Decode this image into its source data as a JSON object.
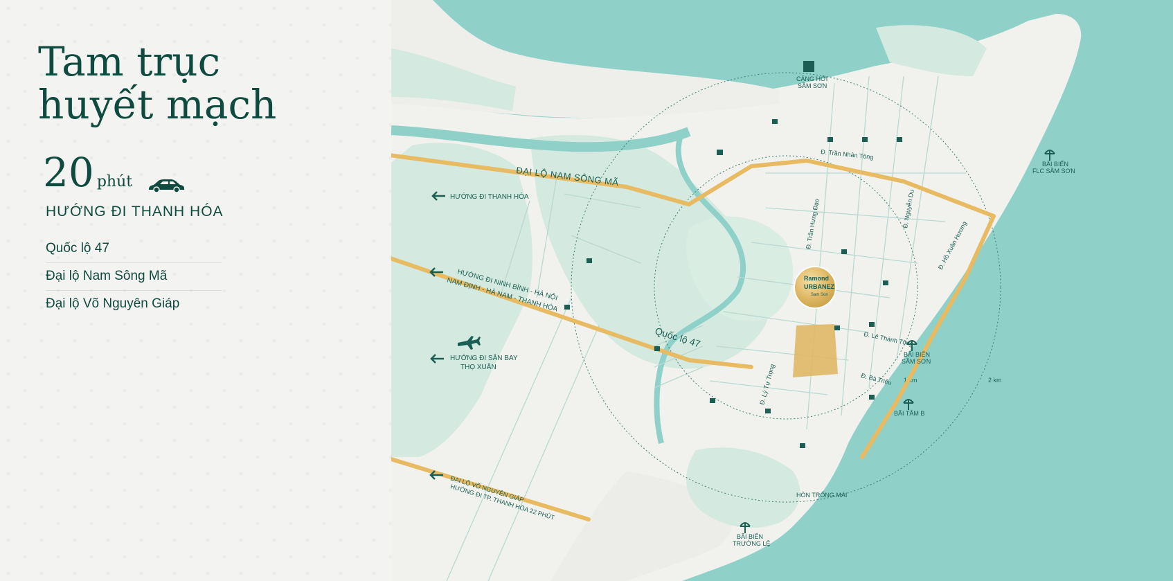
{
  "left": {
    "title_line1": "Tam trục",
    "title_line2": "huyết mạch",
    "duration_value": "20",
    "duration_unit": "phút",
    "direction": "HƯỚNG ĐI THANH HÓA",
    "routes": [
      "Quốc lộ 47",
      "Đại lộ Nam Sông Mã",
      "Đại lộ Võ Nguyên Giáp"
    ]
  },
  "map": {
    "roads": {
      "nam_song_ma": "ĐẠI LỘ NAM SÔNG MÃ",
      "quoc_lo_47": "Quốc lộ 47",
      "vo_nguyen_giap": "ĐẠI LỘ VÕ NGUYÊN GIÁP",
      "ho_xuan_huong": "Đ. Hồ Xuân Hương",
      "le_thanh_tong": "Đ. Lê Thánh Tông",
      "ba_trieu": "Đ. Bà Triệu",
      "ly_tu_trong": "Đ. Lý Tự Trọng",
      "tran_nhan_tong": "Đ. Trần Nhân Tông",
      "nguyen_du": "Đ. Nguyễn Du",
      "tran_hung_dao": "Đ. Trần Hưng Đạo"
    },
    "directions": {
      "thanh_hoa": "HƯỚNG ĐI THANH HÓA",
      "ninh_binh_1": "HƯỚNG ĐI NINH BÌNH - HÀ NỘI",
      "ninh_binh_2": "NAM ĐỊNH - HÀ NAM - THANH HÓA",
      "airport_1": "HƯỚNG ĐI SÂN BAY",
      "airport_2": "THỌ XUÂN",
      "vng_2": "HƯỚNG ĐI TP. THANH HÓA 22 PHÚT"
    },
    "places": {
      "cang_hoi_1": "CẢNG HỚI",
      "cang_hoi_2": "SẦM SƠN",
      "flc_1": "BÃI BIỂN",
      "flc_2": "FLC SẦM SƠN",
      "sam_son_1": "BÃI BIỂN",
      "sam_son_2": "SẦM SƠN",
      "tam_b": "BÃI TẮM B",
      "hon_trong_mai": "HÒN TRỐNG MÁI",
      "truong_le_1": "BÃI BIỂN",
      "truong_le_2": "TRƯỜNG LỆ"
    },
    "project": {
      "line1": "Ramond",
      "line2": "URBANEZ",
      "line3": "Sam Son"
    },
    "radius": {
      "inner": "1 km",
      "outer": "2 km"
    },
    "colors": {
      "sea": "#8fd1c9",
      "land": "#f1f1ee",
      "green": "#d4e9df",
      "road": "#e8bb63",
      "label": "#1b5f54"
    }
  }
}
